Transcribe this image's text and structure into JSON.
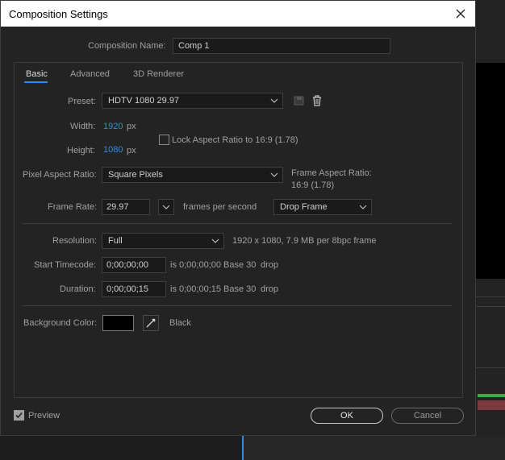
{
  "dialog": {
    "title": "Composition Settings",
    "comp_name_label": "Composition Name:",
    "comp_name_value": "Comp 1",
    "tabs": [
      {
        "label": "Basic",
        "active": true
      },
      {
        "label": "Advanced",
        "active": false
      },
      {
        "label": "3D Renderer",
        "active": false
      }
    ],
    "basic": {
      "preset_label": "Preset:",
      "preset_value": "HDTV 1080 29.97",
      "width_label": "Width:",
      "width_value": "1920",
      "height_label": "Height:",
      "height_value": "1080",
      "unit_px": "px",
      "lock_aspect_label": "Lock Aspect Ratio to 16:9 (1.78)",
      "lock_aspect_checked": false,
      "pixel_aspect_label": "Pixel Aspect Ratio:",
      "pixel_aspect_value": "Square Pixels",
      "frame_aspect_label": "Frame Aspect Ratio:",
      "frame_aspect_value": "16:9 (1.78)",
      "frame_rate_label": "Frame Rate:",
      "frame_rate_value": "29.97",
      "frames_per_second": "frames per second",
      "drop_frame_value": "Drop Frame",
      "resolution_label": "Resolution:",
      "resolution_value": "Full",
      "resolution_info": "1920 x 1080, 7.9 MB per 8bpc frame",
      "start_tc_label": "Start Timecode:",
      "start_tc_value": "0;00;00;00",
      "start_tc_info": "is 0;00;00;00",
      "start_tc_base": "Base 30",
      "start_tc_drop": "drop",
      "duration_label": "Duration:",
      "duration_value": "0;00;00;15",
      "duration_info": "is 0;00;00;15",
      "duration_base": "Base 30",
      "duration_drop": "drop",
      "bg_color_label": "Background Color:",
      "bg_color_name": "Black",
      "bg_color_hex": "#000000"
    },
    "footer": {
      "preview_label": "Preview",
      "preview_checked": true,
      "ok_label": "OK",
      "cancel_label": "Cancel"
    }
  },
  "icons": [
    "close-icon",
    "chevron-down-icon",
    "save-preset-icon",
    "trash-icon",
    "eyedropper-icon",
    "checkmark-icon"
  ],
  "colors": {
    "accent": "#2d8ceb",
    "dialog_bg": "#232323",
    "field_bg": "#1a1a1a"
  }
}
